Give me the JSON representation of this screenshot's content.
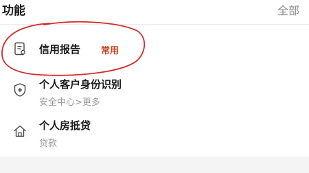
{
  "header": {
    "title": "功能",
    "all_label": "全部"
  },
  "items": [
    {
      "icon": "report-document-icon",
      "title": "信用报告",
      "badge": "常用"
    },
    {
      "icon": "shield-plus-icon",
      "title": "个人客户身份识别",
      "subtitle": "安全中心>更多"
    },
    {
      "icon": "house-icon",
      "title": "个人房抵贷",
      "subtitle": "贷款"
    }
  ],
  "colors": {
    "badge": "#c9421e",
    "annotation_circle": "#d42a2a",
    "muted_text": "#9a9a9a"
  }
}
